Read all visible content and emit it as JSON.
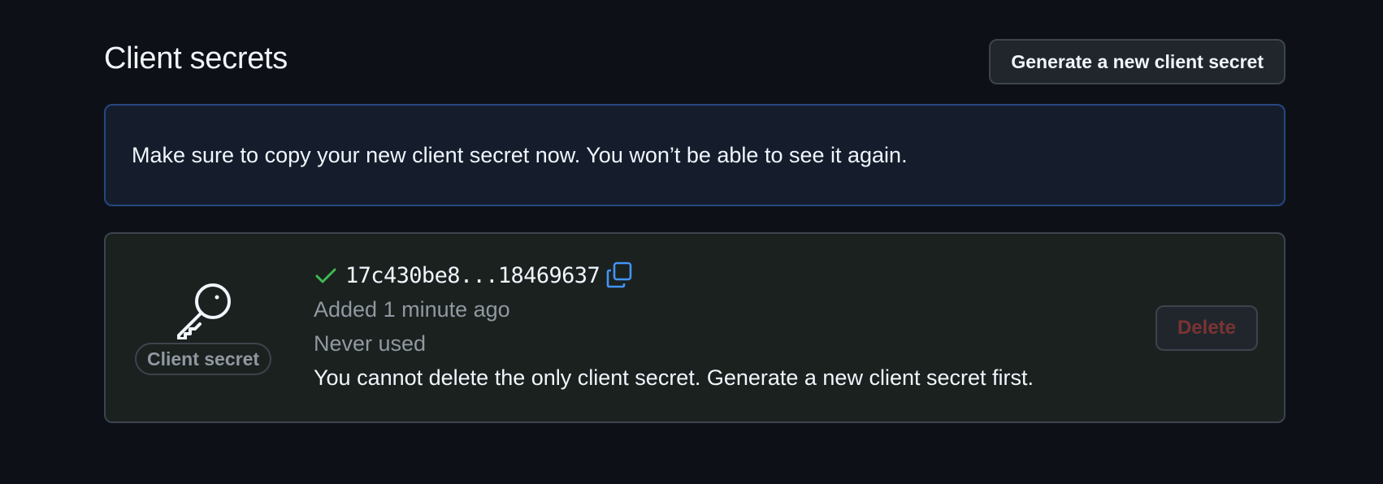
{
  "header": {
    "title": "Client secrets",
    "generate_button_label": "Generate a new client secret"
  },
  "flash": {
    "message": "Make sure to copy your new client secret now. You won’t be able to see it again."
  },
  "secret": {
    "label": "Client secret",
    "icon": "key-icon",
    "value": "17c430be8...18469637",
    "added": "Added 1 minute ago",
    "usage": "Never used",
    "warning": "You cannot delete the only client secret. Generate a new client secret first.",
    "delete_label": "Delete",
    "delete_disabled": true
  },
  "colors": {
    "background": "#0d1117",
    "flash_border": "#264680",
    "success_check": "#3fb950",
    "copy_icon": "#4493f8",
    "danger_disabled": "#7a3332"
  }
}
